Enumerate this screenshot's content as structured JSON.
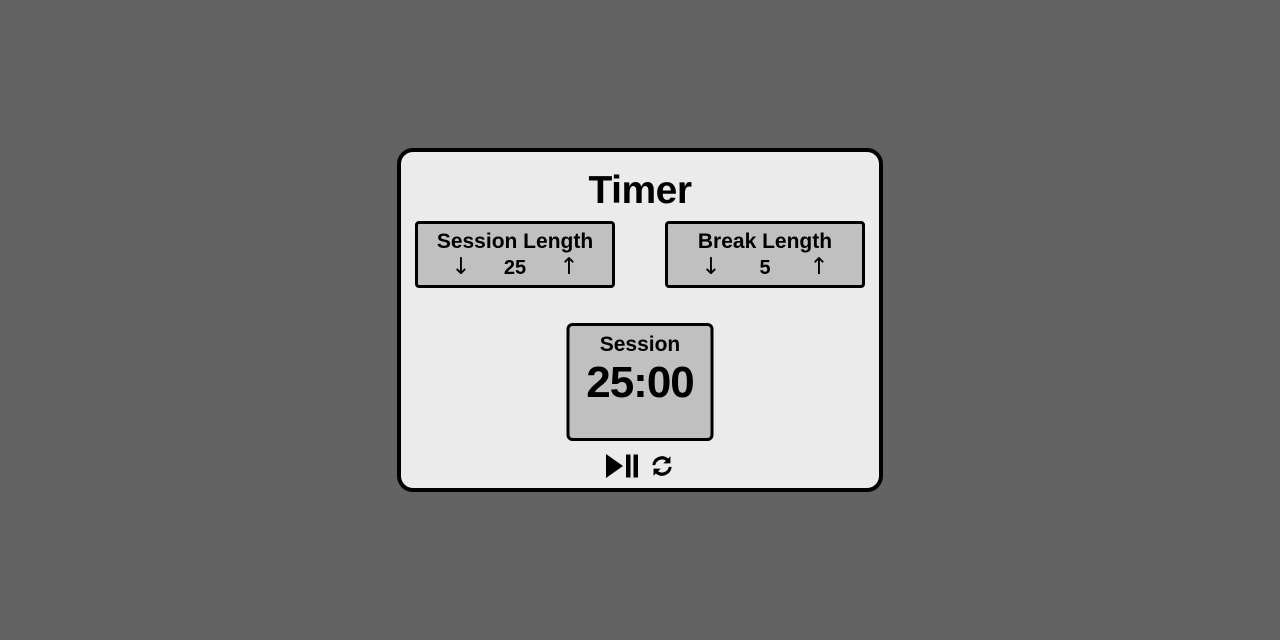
{
  "app": {
    "title": "Timer",
    "background_color": "#636363",
    "panel_color": "#ebebeb",
    "box_color": "#c0c0c0",
    "border_color": "#000000"
  },
  "session_length": {
    "label": "Session Length",
    "value": "25",
    "decrement_icon": "↓",
    "increment_icon": "↑"
  },
  "break_length": {
    "label": "Break Length",
    "value": "5",
    "decrement_icon": "↓",
    "increment_icon": "↑"
  },
  "timer": {
    "label": "Session",
    "value": "25:00"
  },
  "controls": {
    "play_pause_icon": "play-pause-icon",
    "reset_icon": "refresh-icon"
  }
}
